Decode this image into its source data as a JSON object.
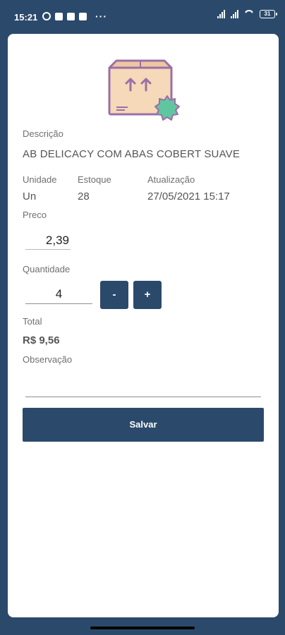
{
  "status_bar": {
    "time": "15:21",
    "battery": "31"
  },
  "product": {
    "description_label": "Descrição",
    "description": "AB DELICACY COM ABAS COBERT SUAVE",
    "unit_label": "Unidade",
    "unit": "Un",
    "stock_label": "Estoque",
    "stock": "28",
    "updated_label": "Atualização",
    "updated": "27/05/2021 15:17",
    "price_label": "Preco",
    "price": "2,39"
  },
  "quantity": {
    "label": "Quantidade",
    "value": "4",
    "minus_label": "-",
    "plus_label": "+"
  },
  "total": {
    "label": "Total",
    "value": "R$ 9,56"
  },
  "notes": {
    "label": "Observação",
    "value": ""
  },
  "actions": {
    "save_label": "Salvar"
  },
  "colors": {
    "primary": "#2b4a6b",
    "box": "#f5d9b8",
    "box_outline": "#9b6fa8",
    "badge": "#5fc7a0"
  },
  "icons": {
    "product": "package-box-icon"
  }
}
